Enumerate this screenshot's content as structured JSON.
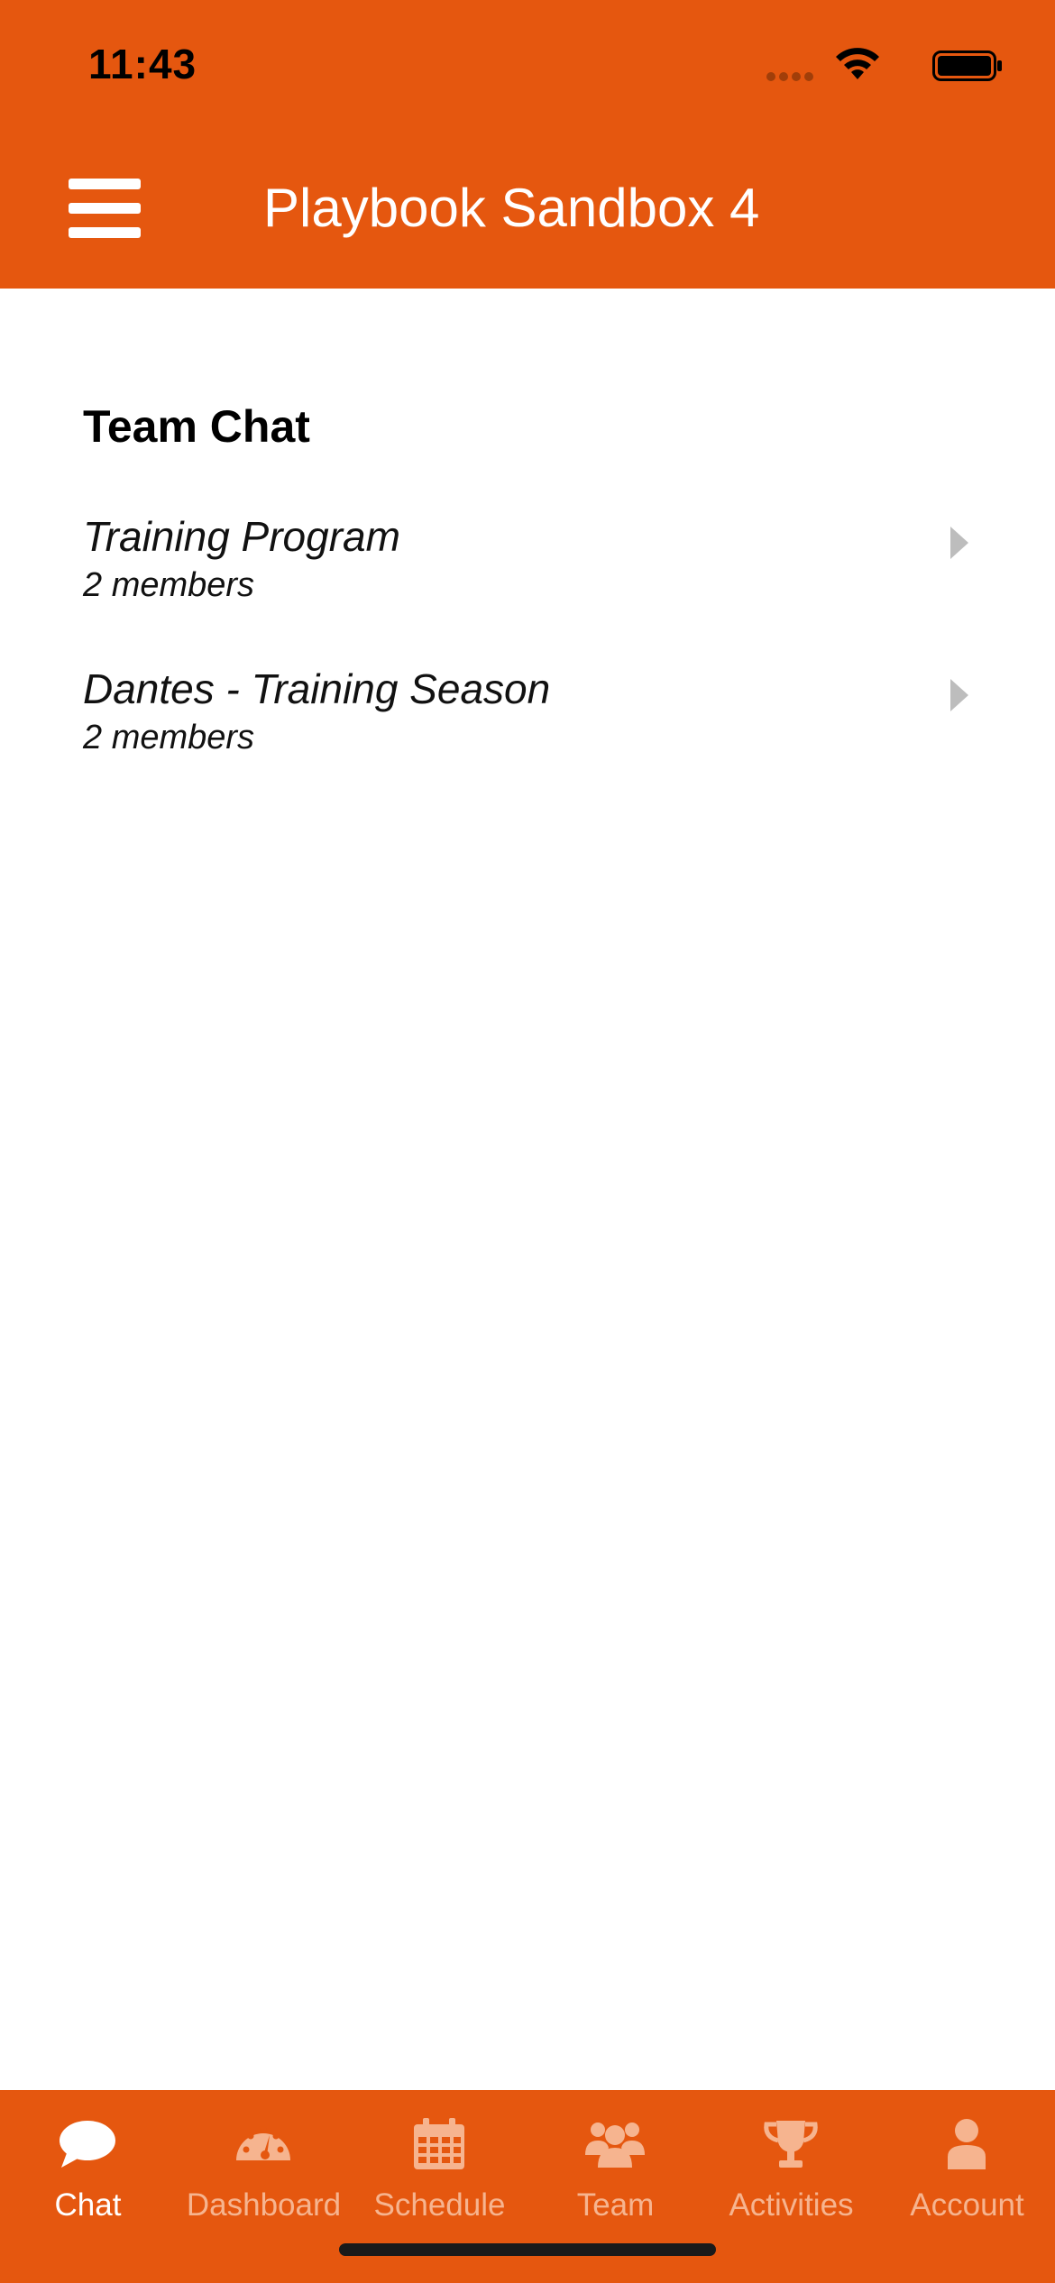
{
  "status_bar": {
    "time": "11:43"
  },
  "header": {
    "title": "Playbook Sandbox 4",
    "menu_icon": "hamburger-icon"
  },
  "section": {
    "title": "Team Chat"
  },
  "chats": [
    {
      "name": "Training Program",
      "members": "2 members"
    },
    {
      "name": "Dantes - Training Season",
      "members": "2 members"
    }
  ],
  "tabs": [
    {
      "label": "Chat",
      "icon": "chat-bubble-icon",
      "active": true
    },
    {
      "label": "Dashboard",
      "icon": "speedometer-icon",
      "active": false
    },
    {
      "label": "Schedule",
      "icon": "calendar-icon",
      "active": false
    },
    {
      "label": "Team",
      "icon": "users-icon",
      "active": false
    },
    {
      "label": "Activities",
      "icon": "trophy-icon",
      "active": false
    },
    {
      "label": "Account",
      "icon": "user-icon",
      "active": false
    }
  ],
  "colors": {
    "brand": "#E5570F",
    "tab_inactive": "#F6B48F",
    "tab_active": "#FFFFFF",
    "chevron": "#BDBDBD"
  }
}
